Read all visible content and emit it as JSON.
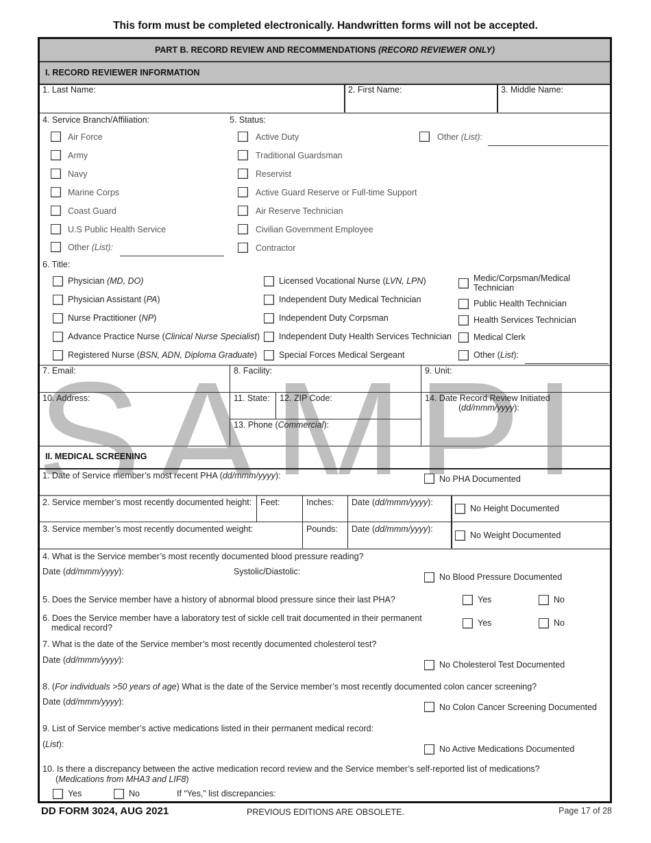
{
  "notice": "This form must be completed electronically. Handwritten forms will not be accepted.",
  "part_header": {
    "main": "PART B.  RECORD REVIEW AND RECOMMENDATIONS ",
    "italic": "(RECORD REVIEWER ONLY)"
  },
  "watermark": "SAMPLE",
  "section1": {
    "title": "I. RECORD REVIEWER INFORMATION",
    "last_name": "1. Last Name:",
    "first_name": "2. First Name:",
    "middle_name": "3. Middle Name:",
    "branch_label": "4. Service Branch/Affiliation:",
    "branches": [
      "Air Force",
      "Army",
      "Navy",
      "Marine Corps",
      "Coast Guard",
      "U.S Public Health Service"
    ],
    "branch_other": {
      "text": "Other ",
      "italic": "(List):"
    },
    "status_label": "5. Status:",
    "statuses": [
      "Active Duty",
      "Traditional Guardsman",
      "Reservist",
      "Active Guard Reserve or Full-time Support",
      "Air Reserve Technician",
      "Civilian Government Employee",
      "Contractor"
    ],
    "status_other": {
      "text": "Other ",
      "italic": "(List)",
      "suffix": ":"
    },
    "title_label": "6. Title:",
    "titles_col1": [
      {
        "text": "Physician ",
        "italic": "(MD, DO)",
        "suffix": ""
      },
      {
        "text": "Physician Assistant (",
        "italic": "PA",
        "suffix": ")"
      },
      {
        "text": "Nurse Practitioner (",
        "italic": "NP",
        "suffix": ")"
      },
      {
        "text": "Advance Practice Nurse (",
        "italic": "Clinical Nurse Specialist",
        "suffix": ")"
      },
      {
        "text": "Registered Nurse (",
        "italic": "BSN, ADN, Diploma Graduate",
        "suffix": ")"
      }
    ],
    "titles_col2": [
      {
        "text": "Licensed Vocational Nurse (",
        "italic": "LVN, LPN",
        "suffix": ")"
      },
      {
        "text": "Independent Duty Medical Technician",
        "italic": "",
        "suffix": ""
      },
      {
        "text": "Independent Duty Corpsman",
        "italic": "",
        "suffix": ""
      },
      {
        "text": "Independent Duty Health Services Technician",
        "italic": "",
        "suffix": ""
      },
      {
        "text": "Special Forces Medical Sergeant",
        "italic": "",
        "suffix": ""
      }
    ],
    "titles_col3": [
      {
        "text": "Medic/Corpsman/Medical Technician",
        "italic": "",
        "suffix": ""
      },
      {
        "text": "Public Health Technician",
        "italic": "",
        "suffix": ""
      },
      {
        "text": "Health Services Technician",
        "italic": "",
        "suffix": ""
      },
      {
        "text": "Medical Clerk",
        "italic": "",
        "suffix": ""
      },
      {
        "text": "Other (",
        "italic": "List",
        "suffix": "):"
      }
    ],
    "email": "7. Email:",
    "facility": "8. Facility:",
    "unit": "9. Unit:",
    "address": "10. Address:",
    "state": "11. State:",
    "zip": "12. ZIP Code:",
    "phone": {
      "text": "13. Phone (",
      "italic": "Commercial",
      "suffix": "):"
    },
    "date_initiated": {
      "text": "14. Date Record Review Initiated",
      "italic": "dd/mmm/yyyy"
    }
  },
  "section2": {
    "title": "II. MEDICAL SCREENING",
    "q1": {
      "text": "1. Date of Service member’s most recent PHA (",
      "italic": "dd/mmm/yyyy",
      "suffix": "):",
      "none": "No PHA Documented"
    },
    "q2": {
      "text": "2. Service member’s most recently documented height:",
      "feet": "Feet:",
      "inches": "Inches:",
      "none": "No Height Documented"
    },
    "q3": {
      "text": "3. Service member’s most recently documented weight:",
      "pounds": "Pounds:",
      "none": "No Weight Documented"
    },
    "date_label": {
      "text": "Date (",
      "italic": "dd/mmm/yyyy",
      "suffix": "):"
    },
    "q4": {
      "text": "4. What is the Service member’s most recently documented blood pressure reading?",
      "systolic": "Systolic/Diastolic:",
      "none": "No Blood Pressure Documented"
    },
    "q5": {
      "text": "5. Does the Service member have a history of abnormal blood pressure since their last PHA?"
    },
    "q6": {
      "text": "6. Does the Service member have a laboratory test of sickle cell trait documented in their permanent",
      "text2": "medical record?"
    },
    "yes": "Yes",
    "no": "No",
    "q7": {
      "text": "7. What is the date of the Service member’s most recently documented cholesterol test?",
      "none": "No Cholesterol Test Documented"
    },
    "q8": {
      "prefix": "8. (",
      "italic": "For individuals >50 years of age",
      "text": ") What is the date of the Service member’s most recently documented colon cancer screening?",
      "none": "No Colon Cancer Screening Documented"
    },
    "q9": {
      "text": "9. List of Service member’s active medications listed in their permanent medical record:",
      "list_italic": "List",
      "none": "No Active Medications Documented"
    },
    "q10": {
      "text": "10. Is there a discrepancy between the active medication record review and the Service member’s self-reported list of medications?",
      "italic": "Medications from MHA3 and LIF8",
      "if_yes": "If “Yes,” list discrepancies:"
    }
  },
  "footer": {
    "form_id": "DD FORM 3024, AUG 2021",
    "obsolete": "PREVIOUS EDITIONS ARE OBSOLETE.",
    "page": "Page 17 of 28"
  }
}
